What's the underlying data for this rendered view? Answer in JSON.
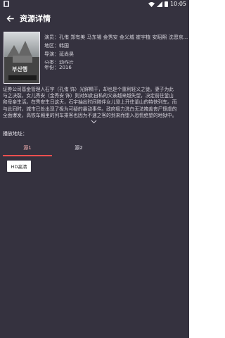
{
  "status_bar": {
    "time": "10:05",
    "colors": {
      "background": "#35323f",
      "text": "#ffffff"
    }
  },
  "app_bar": {
    "title": "资源详情",
    "back_icon": "arrow-left-icon"
  },
  "movie": {
    "actors": "演员：孔侑 郑有美 马东锡 金秀安 金义城 崔宇植 安昭熙 沈恩京...",
    "region": "地区：韩国",
    "director": "导演：延尚昊",
    "genre": "分类：动作片",
    "year": "年份：2016",
    "synopsis_lines": [
      "证券公司基金管理人石宇（孔侑 饰）光鲜精干，却也是个重利轻义之徒。妻子为此",
      "与之决裂，女儿秀安（金秀安 饰）则对如此自私的父亲越来越失望，决定前往釜山",
      "和母亲生活。在秀安生日这天，石宇抽出时间陪伴女儿登上开往釜山的特快列车。而",
      "与此同时，城市已处出现了极为可疑的暴动事件。政府极力洗白无法掩盖丧尸肆虐的",
      "全面爆发，高铁车厢里的列车乘客也因为不速之客的到来而堕入恐慌绝望的地狱中。"
    ]
  },
  "play": {
    "label": "播放地址：",
    "tabs": [
      "源1",
      "源2"
    ],
    "source_button": "HD高清"
  },
  "colors": {
    "accent": "#ff4f4f",
    "panel": "#35323f",
    "text": "#d8d6de"
  }
}
